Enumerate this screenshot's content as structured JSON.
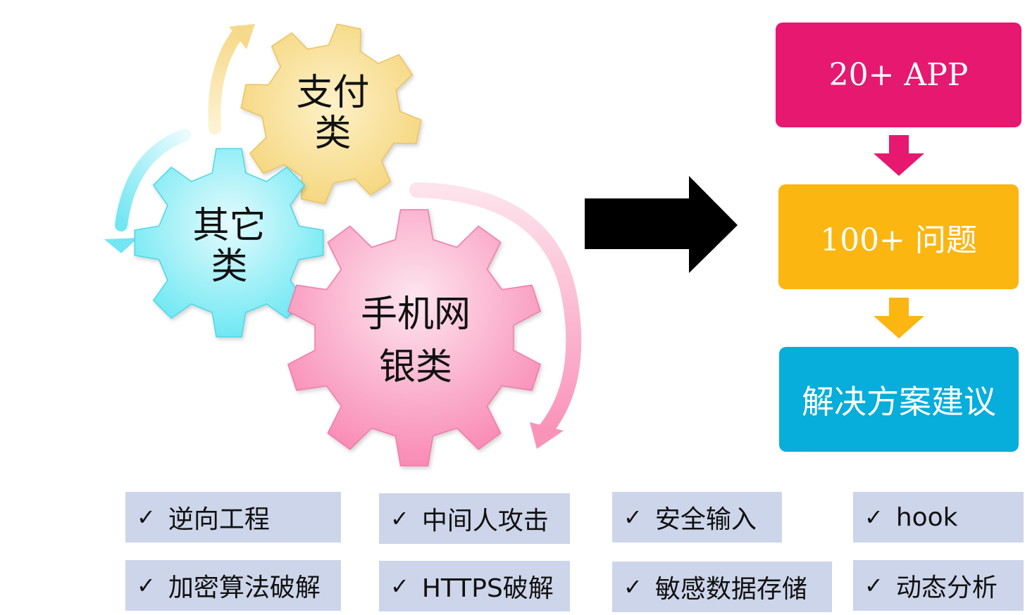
{
  "gears": {
    "pay": {
      "line1": "支付",
      "line2": "类"
    },
    "other": {
      "line1": "其它",
      "line2": "类"
    },
    "bank": {
      "line1": "手机网",
      "line2": "银类"
    }
  },
  "flow": {
    "step1": "20+ APP",
    "step2": "100+ 问题",
    "step3": "解决方案建议"
  },
  "tags": {
    "check_mark": "✓",
    "items": [
      "逆向工程",
      "中间人攻击",
      "安全输入",
      "hook",
      "加密算法破解",
      "HTTPS破解",
      "敏感数据存储",
      "动态分析"
    ]
  },
  "colors": {
    "pay_gear": "#f8df92",
    "other_gear": "#8ef1f7",
    "bank_gear": "#fc9cc0",
    "step1_box": "#e6186f",
    "step2_box": "#fbb612",
    "step3_box": "#07addb",
    "tag_bg": "#cdd5ea"
  }
}
